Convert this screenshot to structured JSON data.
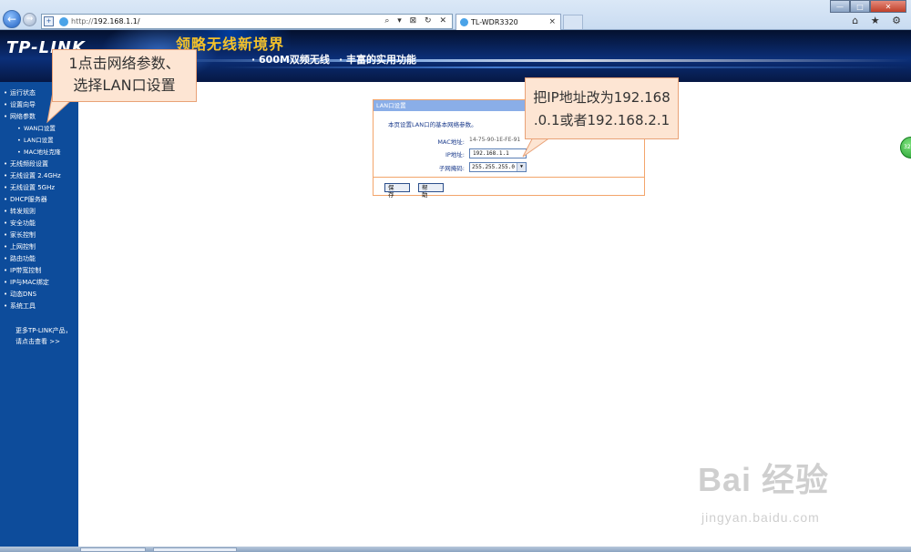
{
  "browser": {
    "url_prefix": "http://",
    "url_host": "192.168.1.1/",
    "address_tools": "⌕ ▾ ⊠ ↻ ✕",
    "tab_title": "TL-WDR3320",
    "back_glyph": "←",
    "forward_glyph": "→",
    "window_controls": {
      "minimize": "—",
      "maximize": "□",
      "close": "✕"
    },
    "right_icons": "⌂ ★ ⚙"
  },
  "banner": {
    "logo": "TP-LINK",
    "slogan": "领略无线新境界",
    "feature_1": "· 600M双频无线",
    "feature_2": "· 丰富的实用功能"
  },
  "sidebar": {
    "items": [
      {
        "label": "运行状态",
        "level": 0
      },
      {
        "label": "设置向导",
        "level": 0
      },
      {
        "label": "网络参数",
        "level": 0
      },
      {
        "label": "WAN口设置",
        "level": 1
      },
      {
        "label": "LAN口设置",
        "level": 1
      },
      {
        "label": "MAC地址克隆",
        "level": 1
      },
      {
        "label": "无线频段设置",
        "level": 0
      },
      {
        "label": "无线设置 2.4GHz",
        "level": 0
      },
      {
        "label": "无线设置 5GHz",
        "level": 0
      },
      {
        "label": "DHCP服务器",
        "level": 0
      },
      {
        "label": "转发规则",
        "level": 0
      },
      {
        "label": "安全功能",
        "level": 0
      },
      {
        "label": "家长控制",
        "level": 0
      },
      {
        "label": "上网控制",
        "level": 0
      },
      {
        "label": "路由功能",
        "level": 0
      },
      {
        "label": "IP带宽控制",
        "level": 0
      },
      {
        "label": "IP与MAC绑定",
        "level": 0
      },
      {
        "label": "动态DNS",
        "level": 0
      },
      {
        "label": "系统工具",
        "level": 0
      }
    ],
    "more_line1": "更多TP-LINK产品，",
    "more_line2": "请点击查看 >>"
  },
  "panel": {
    "title": "LAN口设置",
    "description": "本页设置LAN口的基本网络参数。",
    "mac_label": "MAC地址:",
    "mac_value": "14-75-90-1E-FE-91",
    "ip_label": "IP地址:",
    "ip_value": "192.168.1.1",
    "mask_label": "子网掩码:",
    "mask_value": "255.255.255.0",
    "save_label": "保 存",
    "help_label": "帮 助"
  },
  "annotations": {
    "step1_line1": "1点击网络参数、",
    "step1_line2": "选择LAN口设置",
    "step2_line1": "把IP地址改为192.168",
    "step2_line2": ".0.1或者192.168.2.1"
  },
  "side_badge": "32",
  "watermark": {
    "brand": "Bai 经验",
    "url": "jingyan.baidu.com"
  },
  "colors": {
    "sidebar_bg": "#0d4c9b",
    "banner_bg": "#0b2f78",
    "panel_header": "#8aaee8",
    "panel_border": "#f3a56b",
    "callout_bg": "#fde5d3",
    "slogan": "#f4c12a"
  }
}
